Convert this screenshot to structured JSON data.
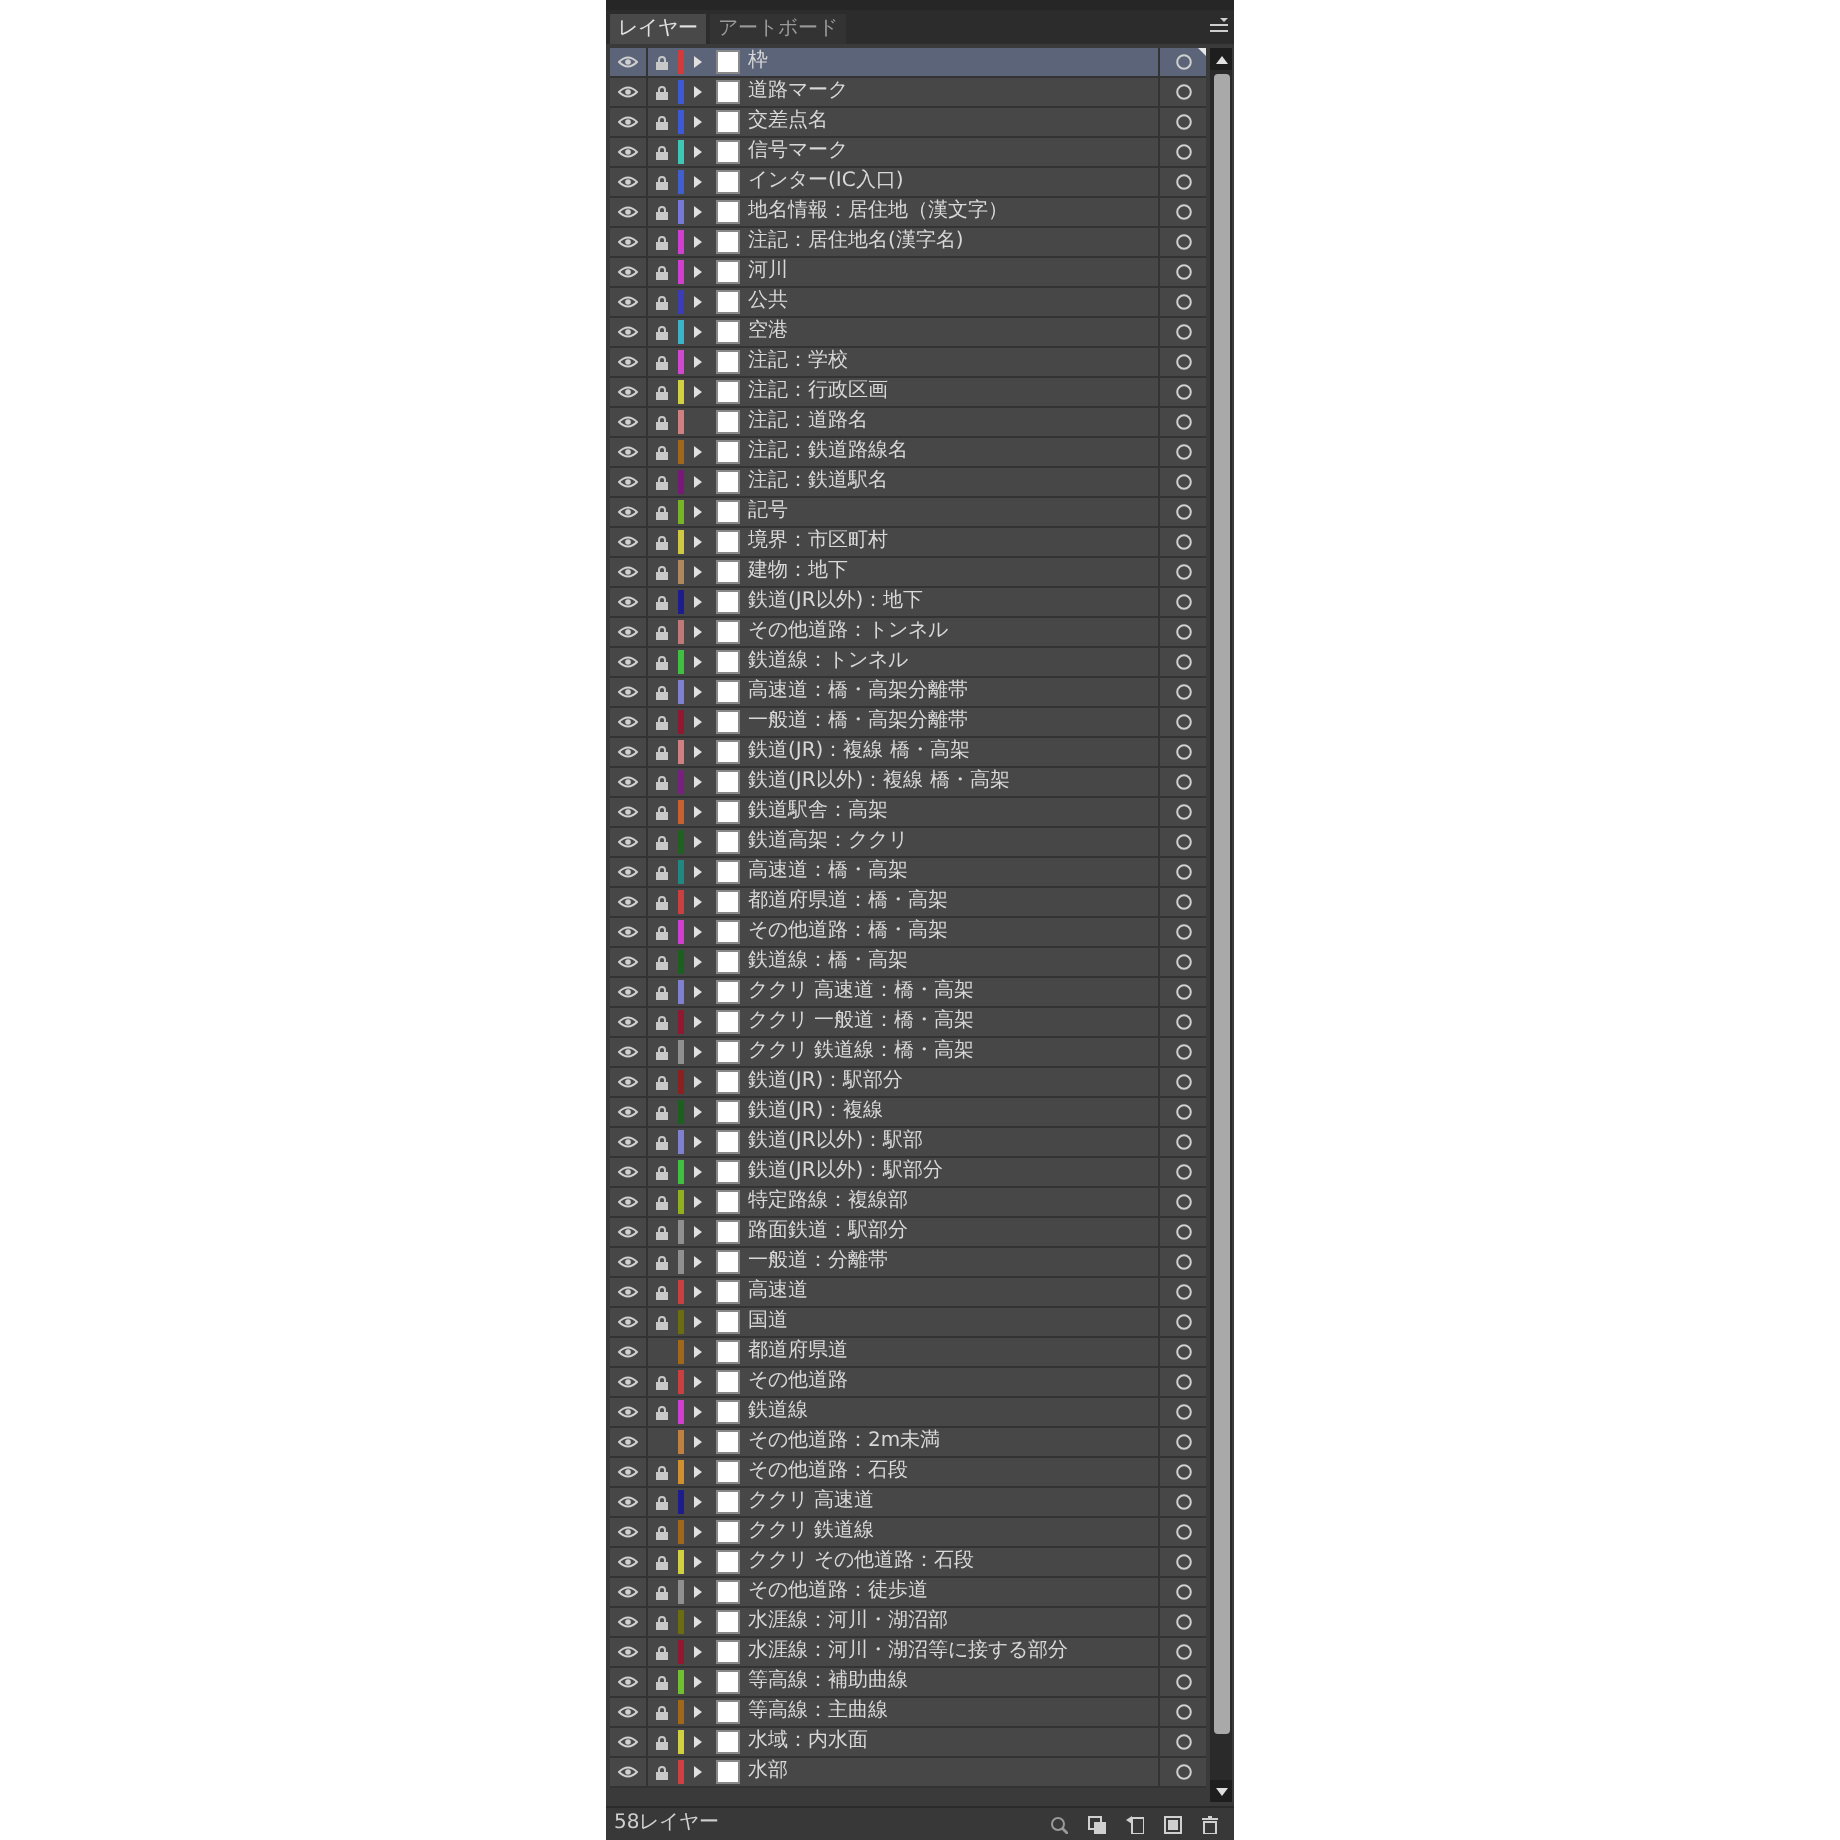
{
  "panel": {
    "tabs": [
      {
        "label": "レイヤー",
        "selected": true
      },
      {
        "label": "アートボード",
        "selected": false
      }
    ],
    "layers": [
      {
        "name": "枠",
        "color": "#d03c3c",
        "visible": true,
        "locked": true,
        "expandable": true,
        "selected": true
      },
      {
        "name": "道路マーク",
        "color": "#3c5ad6",
        "visible": true,
        "locked": true,
        "expandable": true,
        "selected": false
      },
      {
        "name": "交差点名",
        "color": "#3c5ad6",
        "visible": true,
        "locked": true,
        "expandable": true,
        "selected": false
      },
      {
        "name": "信号マーク",
        "color": "#3cc8b4",
        "visible": true,
        "locked": true,
        "expandable": true,
        "selected": false
      },
      {
        "name": "インター(IC入口)",
        "color": "#4060d0",
        "visible": true,
        "locked": true,
        "expandable": true,
        "selected": false
      },
      {
        "name": "地名情報：居住地（漢文字）",
        "color": "#7878d8",
        "visible": true,
        "locked": true,
        "expandable": true,
        "selected": false
      },
      {
        "name": "注記：居住地名(漢字名)",
        "color": "#d040d0",
        "visible": true,
        "locked": true,
        "expandable": true,
        "selected": false
      },
      {
        "name": "河川",
        "color": "#d040d0",
        "visible": true,
        "locked": true,
        "expandable": true,
        "selected": false
      },
      {
        "name": "公共",
        "color": "#3c3cb8",
        "visible": true,
        "locked": true,
        "expandable": true,
        "selected": false
      },
      {
        "name": "空港",
        "color": "#3cb4c8",
        "visible": true,
        "locked": true,
        "expandable": true,
        "selected": false
      },
      {
        "name": "注記：学校",
        "color": "#d048d0",
        "visible": true,
        "locked": true,
        "expandable": true,
        "selected": false
      },
      {
        "name": "注記：行政区画",
        "color": "#d0d040",
        "visible": true,
        "locked": true,
        "expandable": true,
        "selected": false
      },
      {
        "name": "注記：道路名",
        "color": "#d08080",
        "visible": true,
        "locked": true,
        "expandable": false,
        "selected": false
      },
      {
        "name": "注記：鉄道路線名",
        "color": "#a06818",
        "visible": true,
        "locked": true,
        "expandable": true,
        "selected": false
      },
      {
        "name": "注記：鉄道駅名",
        "color": "#781878",
        "visible": true,
        "locked": true,
        "expandable": true,
        "selected": false
      },
      {
        "name": "記号",
        "color": "#78b428",
        "visible": true,
        "locked": true,
        "expandable": true,
        "selected": false
      },
      {
        "name": "境界：市区町村",
        "color": "#d0c840",
        "visible": true,
        "locked": true,
        "expandable": true,
        "selected": false
      },
      {
        "name": "建物：地下",
        "color": "#b08860",
        "visible": true,
        "locked": true,
        "expandable": true,
        "selected": false
      },
      {
        "name": "鉄道(JR以外)：地下",
        "color": "#1c1c8c",
        "visible": true,
        "locked": true,
        "expandable": true,
        "selected": false
      },
      {
        "name": "その他道路：トンネル",
        "color": "#c07878",
        "visible": true,
        "locked": true,
        "expandable": true,
        "selected": false
      },
      {
        "name": "鉄道線：トンネル",
        "color": "#40c040",
        "visible": true,
        "locked": true,
        "expandable": true,
        "selected": false
      },
      {
        "name": "高速道：橋・高架分離帯",
        "color": "#8080d0",
        "visible": true,
        "locked": true,
        "expandable": true,
        "selected": false
      },
      {
        "name": "一般道：橋・高架分離帯",
        "color": "#901830",
        "visible": true,
        "locked": true,
        "expandable": true,
        "selected": false
      },
      {
        "name": "鉄道(JR)：複線 橋・高架",
        "color": "#d08080",
        "visible": true,
        "locked": true,
        "expandable": true,
        "selected": false
      },
      {
        "name": "鉄道(JR以外)：複線 橋・高架",
        "color": "#782080",
        "visible": true,
        "locked": true,
        "expandable": true,
        "selected": false
      },
      {
        "name": "鉄道駅舎：高架",
        "color": "#c86030",
        "visible": true,
        "locked": true,
        "expandable": true,
        "selected": false
      },
      {
        "name": "鉄道高架：ククリ",
        "color": "#206020",
        "visible": true,
        "locked": true,
        "expandable": true,
        "selected": false
      },
      {
        "name": "高速道：橋・高架",
        "color": "#208880",
        "visible": true,
        "locked": true,
        "expandable": true,
        "selected": false
      },
      {
        "name": "都道府県道：橋・高架",
        "color": "#c84040",
        "visible": true,
        "locked": true,
        "expandable": true,
        "selected": false
      },
      {
        "name": "その他道路：橋・高架",
        "color": "#d040d0",
        "visible": true,
        "locked": true,
        "expandable": true,
        "selected": false
      },
      {
        "name": "鉄道線：橋・高架",
        "color": "#1c6020",
        "visible": true,
        "locked": true,
        "expandable": true,
        "selected": false
      },
      {
        "name": "ククリ 高速道：橋・高架",
        "color": "#8080d0",
        "visible": true,
        "locked": true,
        "expandable": true,
        "selected": false
      },
      {
        "name": "ククリ 一般道：橋・高架",
        "color": "#901830",
        "visible": true,
        "locked": true,
        "expandable": true,
        "selected": false
      },
      {
        "name": "ククリ 鉄道線：橋・高架",
        "color": "#909090",
        "visible": true,
        "locked": true,
        "expandable": true,
        "selected": false
      },
      {
        "name": "鉄道(JR)：駅部分",
        "color": "#8c2020",
        "visible": true,
        "locked": true,
        "expandable": true,
        "selected": false
      },
      {
        "name": "鉄道(JR)：複線",
        "color": "#1c6020",
        "visible": true,
        "locked": true,
        "expandable": true,
        "selected": false
      },
      {
        "name": "鉄道(JR以外)：駅部",
        "color": "#8080d0",
        "visible": true,
        "locked": true,
        "expandable": true,
        "selected": false
      },
      {
        "name": "鉄道(JR以外)：駅部分",
        "color": "#40c040",
        "visible": true,
        "locked": true,
        "expandable": true,
        "selected": false
      },
      {
        "name": "特定路線：複線部",
        "color": "#90b020",
        "visible": true,
        "locked": true,
        "expandable": true,
        "selected": false
      },
      {
        "name": "路面鉄道：駅部分",
        "color": "#909090",
        "visible": true,
        "locked": true,
        "expandable": true,
        "selected": false
      },
      {
        "name": "一般道：分離帯",
        "color": "#909090",
        "visible": true,
        "locked": true,
        "expandable": true,
        "selected": false
      },
      {
        "name": "高速道",
        "color": "#c84040",
        "visible": true,
        "locked": true,
        "expandable": true,
        "selected": false
      },
      {
        "name": "国道",
        "color": "#6c6c10",
        "visible": true,
        "locked": true,
        "expandable": true,
        "selected": false
      },
      {
        "name": "都道府県道",
        "color": "#a06818",
        "visible": true,
        "locked": false,
        "expandable": true,
        "selected": false
      },
      {
        "name": "その他道路",
        "color": "#c84040",
        "visible": true,
        "locked": true,
        "expandable": true,
        "selected": false
      },
      {
        "name": "鉄道線",
        "color": "#d040d0",
        "visible": true,
        "locked": true,
        "expandable": true,
        "selected": false
      },
      {
        "name": "その他道路：2m未満",
        "color": "#c08040",
        "visible": true,
        "locked": false,
        "expandable": true,
        "selected": false
      },
      {
        "name": "その他道路：石段",
        "color": "#d09030",
        "visible": true,
        "locked": true,
        "expandable": true,
        "selected": false
      },
      {
        "name": "ククリ 高速道",
        "color": "#1c1c8c",
        "visible": true,
        "locked": true,
        "expandable": true,
        "selected": false
      },
      {
        "name": "ククリ 鉄道線",
        "color": "#a06818",
        "visible": true,
        "locked": true,
        "expandable": true,
        "selected": false
      },
      {
        "name": "ククリ その他道路：石段",
        "color": "#d0d040",
        "visible": true,
        "locked": true,
        "expandable": true,
        "selected": false
      },
      {
        "name": "その他道路：徒歩道",
        "color": "#909090",
        "visible": true,
        "locked": true,
        "expandable": true,
        "selected": false
      },
      {
        "name": "水涯線：河川・湖沼部",
        "color": "#6c6c10",
        "visible": true,
        "locked": true,
        "expandable": true,
        "selected": false
      },
      {
        "name": "水涯線：河川・湖沼等に接する部分",
        "color": "#901830",
        "visible": true,
        "locked": true,
        "expandable": true,
        "selected": false
      },
      {
        "name": "等高線：補助曲線",
        "color": "#70c030",
        "visible": true,
        "locked": true,
        "expandable": true,
        "selected": false
      },
      {
        "name": "等高線：主曲線",
        "color": "#a06818",
        "visible": true,
        "locked": true,
        "expandable": true,
        "selected": false
      },
      {
        "name": "水域：内水面",
        "color": "#d0d040",
        "visible": true,
        "locked": true,
        "expandable": true,
        "selected": false
      },
      {
        "name": "水部",
        "color": "#d04040",
        "visible": true,
        "locked": true,
        "expandable": true,
        "selected": false
      }
    ],
    "footer": {
      "layer_count": "58レイヤー"
    }
  }
}
